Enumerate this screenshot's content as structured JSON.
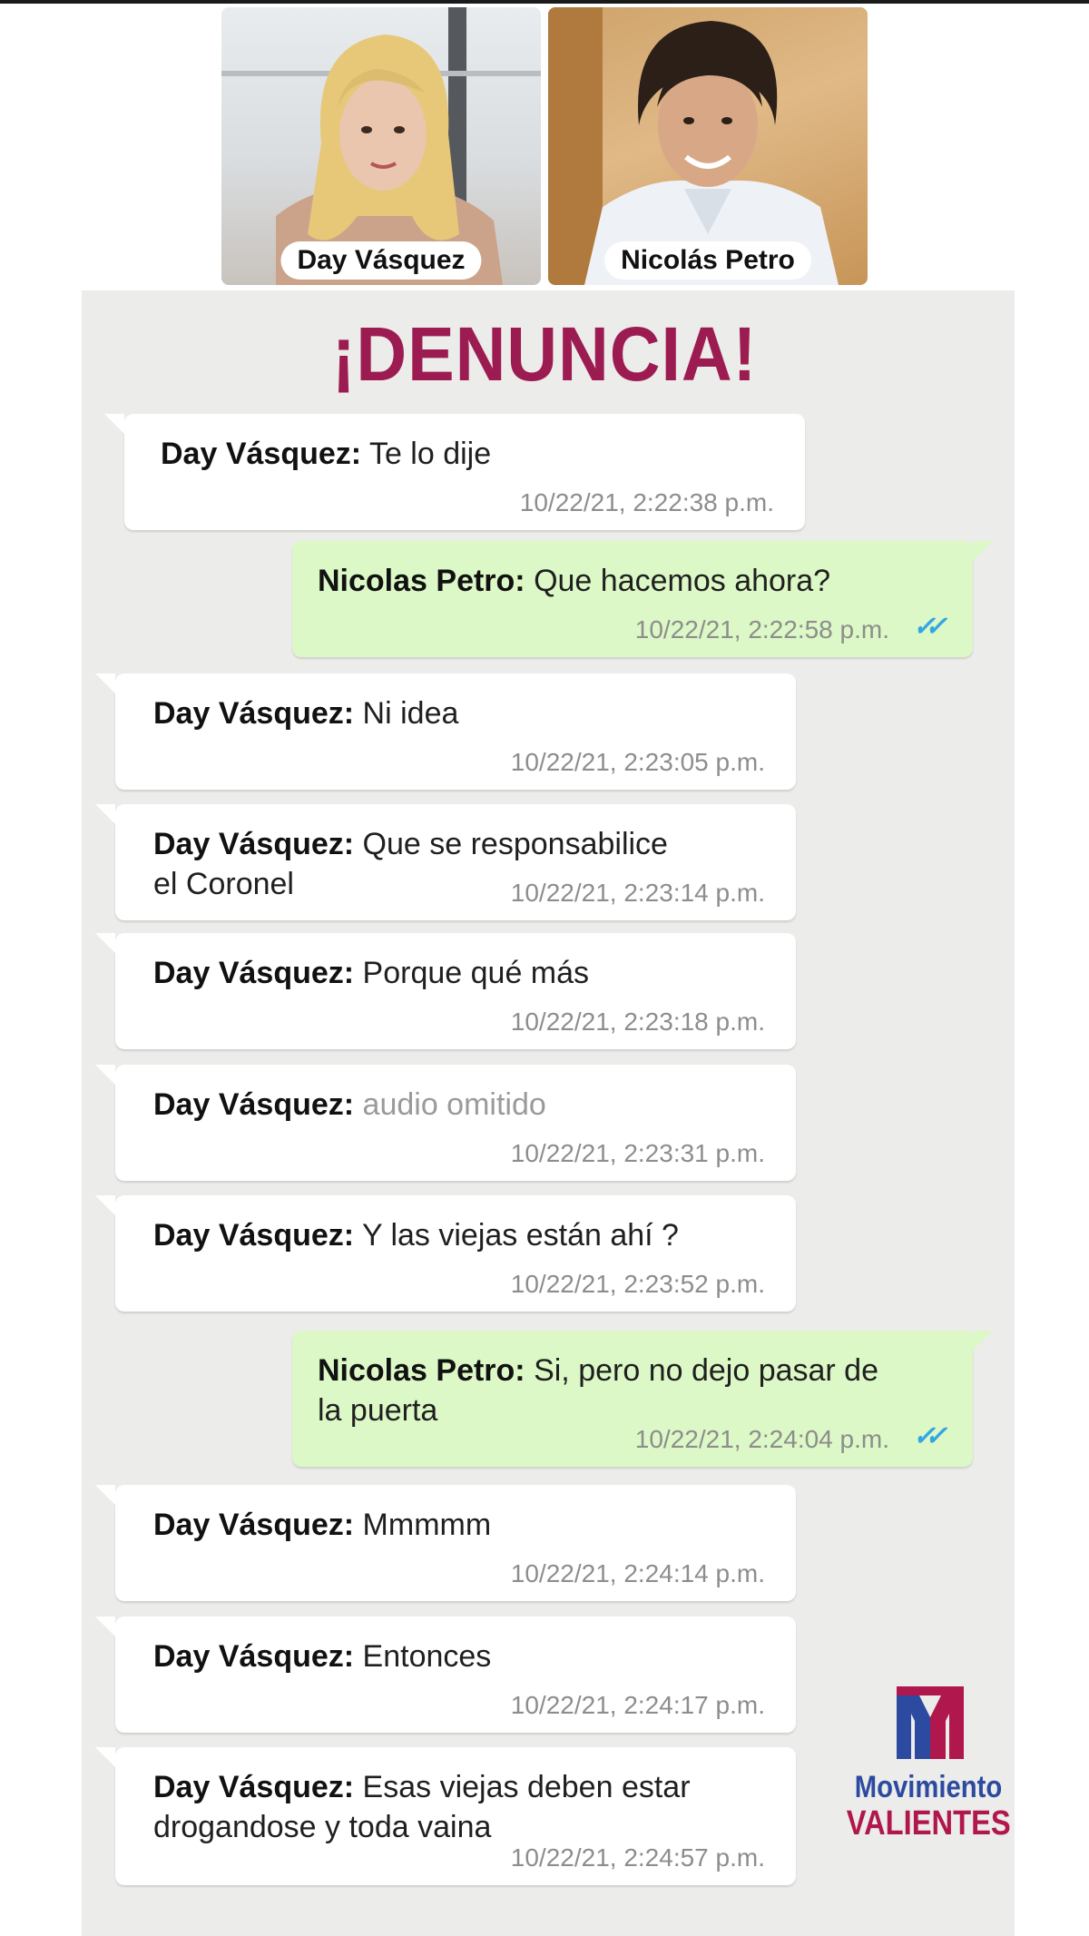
{
  "profiles": {
    "left_name": "Day Vásquez",
    "right_name": "Nicolás Petro"
  },
  "headline": "¡DENUNCIA!",
  "messages": [
    {
      "direction": "in",
      "sender": "Day Vásquez:",
      "text": "Te lo dije",
      "time": "10/22/21, 2:22:38 p.m."
    },
    {
      "direction": "out",
      "sender": "Nicolas Petro:",
      "text": "Que hacemos ahora?",
      "time": "10/22/21, 2:22:58 p.m.",
      "read": true
    },
    {
      "direction": "in",
      "sender": "Day Vásquez:",
      "text": "Ni idea",
      "time": "10/22/21, 2:23:05 p.m."
    },
    {
      "direction": "in",
      "sender": "Day Vásquez:",
      "text": "Que se responsabilice",
      "text2": "el Coronel",
      "time": "10/22/21, 2:23:14 p.m."
    },
    {
      "direction": "in",
      "sender": "Day Vásquez:",
      "text": "Porque qué más",
      "time": "10/22/21, 2:23:18 p.m."
    },
    {
      "direction": "in",
      "sender": "Day Vásquez:",
      "text": "audio omitido",
      "muted": true,
      "time": "10/22/21, 2:23:31 p.m."
    },
    {
      "direction": "in",
      "sender": "Day Vásquez:",
      "text": "Y las viejas están ahí ?",
      "time": "10/22/21, 2:23:52 p.m."
    },
    {
      "direction": "out",
      "sender": "Nicolas Petro:",
      "text": "Si, pero no dejo pasar de",
      "text2": "la puerta",
      "time": "10/22/21, 2:24:04 p.m.",
      "read": true
    },
    {
      "direction": "in",
      "sender": "Day Vásquez:",
      "text": "Mmmmm",
      "time": "10/22/21, 2:24:14 p.m."
    },
    {
      "direction": "in",
      "sender": "Day Vásquez:",
      "text": "Entonces",
      "time": "10/22/21, 2:24:17 p.m."
    },
    {
      "direction": "in",
      "sender": "Day Vásquez:",
      "text": "Esas viejas deben estar",
      "text2": "drogandose y toda vaina",
      "time": "10/22/21, 2:24:57 p.m."
    }
  ],
  "logo": {
    "line1": "Movimiento",
    "line2": "VALIENTES"
  },
  "colors": {
    "headline": "#9c1c52",
    "incoming_bubble": "#ffffff",
    "outgoing_bubble": "#dcf8c6",
    "read_checks": "#34a6e5",
    "panel_background": "#ececea"
  }
}
